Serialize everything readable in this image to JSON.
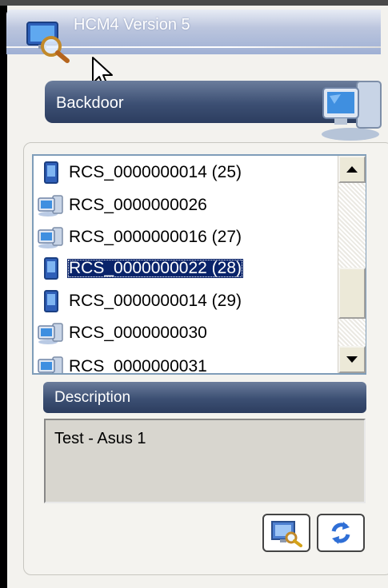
{
  "window": {
    "title": "HCM4 Version 5"
  },
  "header": {
    "label": "Backdoor"
  },
  "list": {
    "items": [
      {
        "label": "RCS_0000000014 (25)",
        "icon": "mobile-device-icon",
        "selected": false
      },
      {
        "label": "RCS_0000000026",
        "icon": "desktop-computer-icon",
        "selected": false
      },
      {
        "label": "RCS_0000000016 (27)",
        "icon": "desktop-computer-icon",
        "selected": false
      },
      {
        "label": "RCS_0000000022 (28)",
        "icon": "mobile-device-icon",
        "selected": true
      },
      {
        "label": "RCS_0000000014 (29)",
        "icon": "mobile-device-icon",
        "selected": false
      },
      {
        "label": "RCS_0000000030",
        "icon": "desktop-computer-icon",
        "selected": false
      },
      {
        "label": "RCS_0000000031",
        "icon": "desktop-computer-icon",
        "selected": false
      }
    ]
  },
  "description": {
    "label": "Description",
    "value": "Test - Asus 1"
  },
  "buttons": {
    "search_icon": "search-computer-icon",
    "refresh_icon": "refresh-icon"
  },
  "colors": {
    "header_bar": "#3c4f73",
    "selection": "#0a246a",
    "list_border": "#7f9db9"
  }
}
